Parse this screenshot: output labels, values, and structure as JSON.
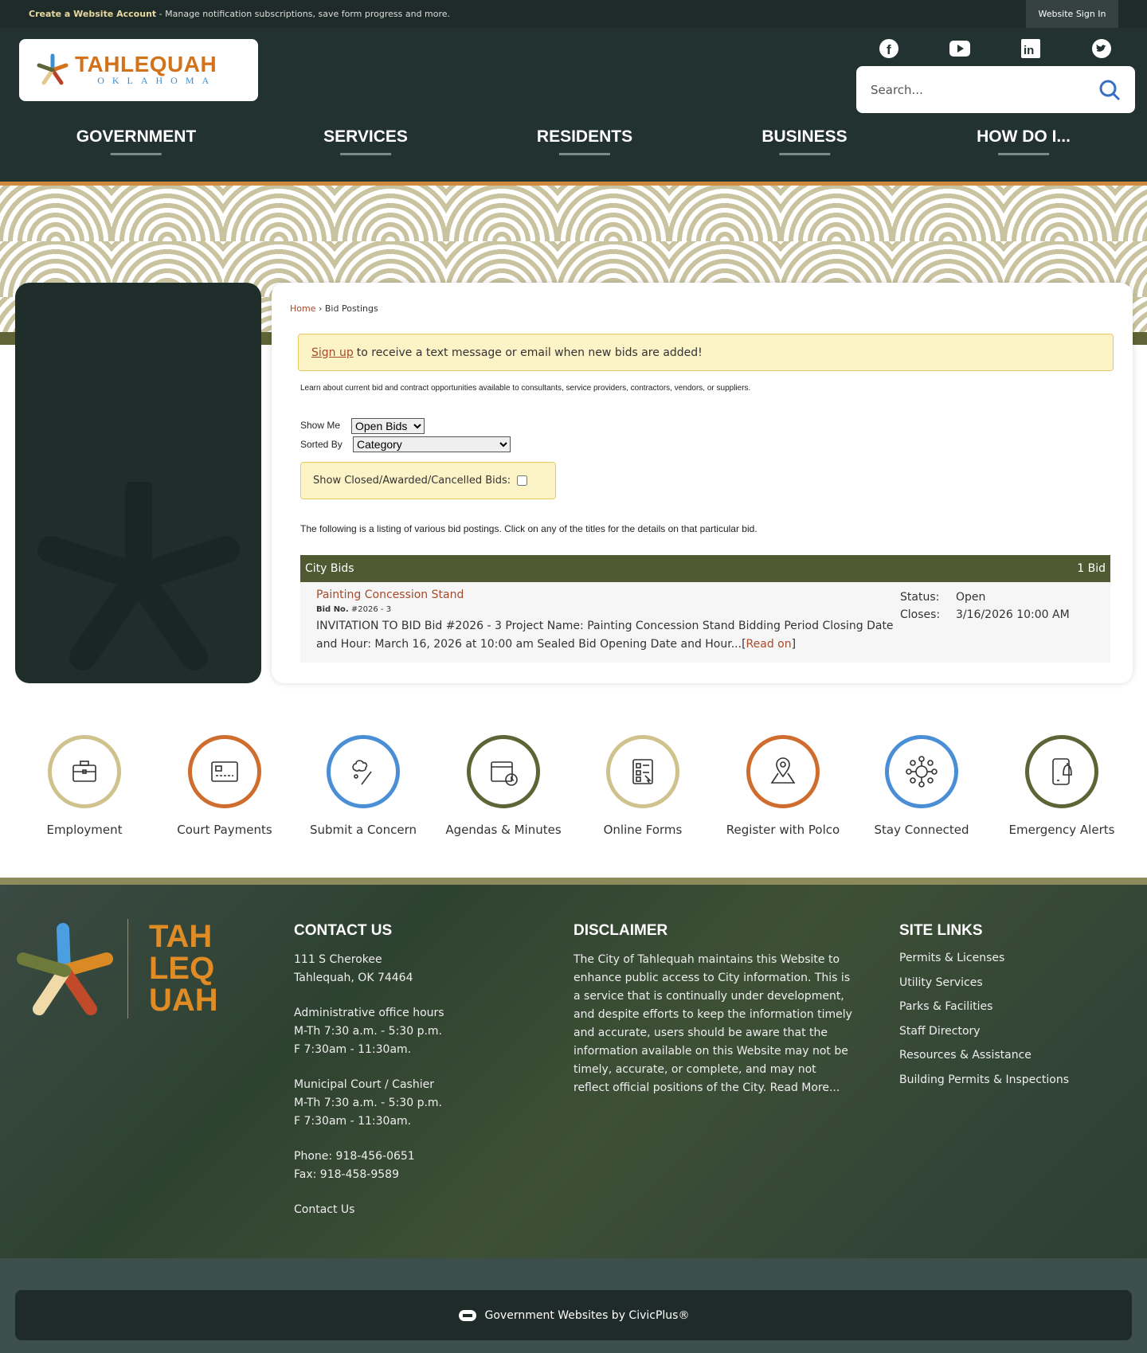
{
  "topbar": {
    "create_account": "Create a Website Account",
    "create_account_desc": " - Manage notification subscriptions, save form progress and more.",
    "sign_in": "Website Sign In"
  },
  "logo": {
    "name": "TAHLEQUAH",
    "sub": "OKLAHOMA"
  },
  "social": [
    "facebook",
    "youtube",
    "linkedin",
    "twitter"
  ],
  "search": {
    "placeholder": "Search..."
  },
  "nav": [
    "GOVERNMENT",
    "SERVICES",
    "RESIDENTS",
    "BUSINESS",
    "HOW DO I..."
  ],
  "breadcrumb": {
    "home": "Home",
    "sep": " › ",
    "current": "Bid Postings"
  },
  "alert": {
    "link": "Sign up",
    "text": "to receive a text message or email when new bids are added!"
  },
  "intro": "Learn about current bid and contract opportunities available to consultants, service providers, contractors, vendors, or suppliers.",
  "filters": {
    "show_me_label": "Show Me",
    "show_me_value": "Open Bids",
    "sorted_by_label": "Sorted By",
    "sorted_by_value": "Category",
    "closed_label": "Show Closed/Awarded/Cancelled Bids:"
  },
  "listing_note": "The following is a listing of various bid postings. Click on any of the titles for the details on that particular bid.",
  "category": {
    "name": "City Bids",
    "count": "1 Bid"
  },
  "bid": {
    "title": "Painting Concession Stand",
    "bid_no_label": "Bid No.",
    "bid_no": "#2026 - 3",
    "desc": "INVITATION TO BID Bid #2026 - 3 Project Name: Painting Concession Stand Bidding Period Closing Date and Hour: March 16, 2026 at 10:00 am Sealed Bid Opening Date and Hour...",
    "read_on": "Read on",
    "status_label": "Status:",
    "status": "Open",
    "closes_label": "Closes:",
    "closes": "3/16/2026 10:00 AM"
  },
  "quick_links": [
    {
      "label": "Employment",
      "icon": "briefcase-icon",
      "color": "#cfc28d"
    },
    {
      "label": "Court Payments",
      "icon": "credit-card-icon",
      "color": "#cf6d2e"
    },
    {
      "label": "Submit a Concern",
      "icon": "thought-pencil-icon",
      "color": "#4a8fd6"
    },
    {
      "label": "Agendas & Minutes",
      "icon": "calendar-clock-icon",
      "color": "#5e6436"
    },
    {
      "label": "Online Forms",
      "icon": "form-icon",
      "color": "#cfc28d"
    },
    {
      "label": "Register with Polco",
      "icon": "map-pin-icon",
      "color": "#cf6d2e"
    },
    {
      "label": "Stay Connected",
      "icon": "network-icon",
      "color": "#4a8fd6"
    },
    {
      "label": "Emergency Alerts",
      "icon": "phone-bell-icon",
      "color": "#5e6436"
    }
  ],
  "footer": {
    "logo": [
      "TAH",
      "LEQ",
      "UAH"
    ],
    "contact": {
      "title": "CONTACT US",
      "lines": [
        "111 S Cherokee",
        "Tahlequah, OK 74464",
        "",
        "Administrative office hours",
        "M-Th 7:30 a.m. - 5:30 p.m.",
        "F 7:30am - 11:30am.",
        "",
        "Municipal Court / Cashier",
        "M-Th 7:30 a.m. - 5:30 p.m.",
        "F 7:30am - 11:30am.",
        "",
        "Phone: 918-456-0651",
        "Fax: 918-458-9589",
        "",
        "Contact Us"
      ]
    },
    "disclaimer": {
      "title": "DISCLAIMER",
      "text": "The City of Tahlequah maintains this Website to enhance public access to City information. This is a service that is continually under development, and despite efforts to keep the information timely and accurate, users should be aware that the information available on this Website may not be timely, accurate, or complete, and may not reflect official positions of the City. Read More..."
    },
    "site_links": {
      "title": "SITE LINKS",
      "items": [
        "Permits & Licenses",
        "Utility Services",
        "Parks & Facilities",
        "Staff Directory",
        "Resources & Assistance",
        "Building Permits & Inspections"
      ]
    },
    "civicplus": "Government Websites by CivicPlus®"
  }
}
